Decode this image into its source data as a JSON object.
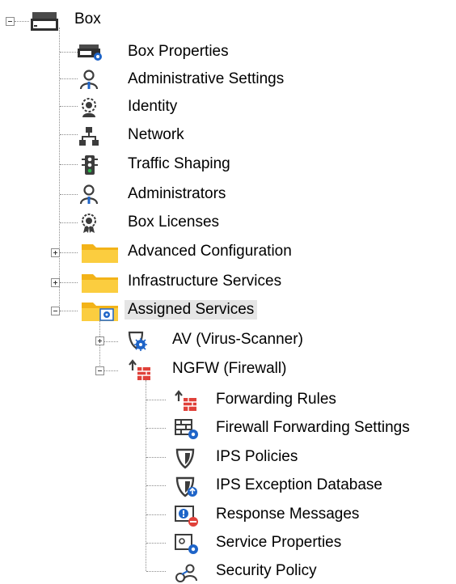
{
  "tree": {
    "root": {
      "label": "Box",
      "expanded": true
    },
    "items": [
      {
        "label": "Box Properties",
        "icon": "box-properties-icon"
      },
      {
        "label": "Administrative Settings",
        "icon": "admin-settings-icon"
      },
      {
        "label": "Identity",
        "icon": "identity-icon"
      },
      {
        "label": "Network",
        "icon": "network-icon"
      },
      {
        "label": "Traffic Shaping",
        "icon": "traffic-light-icon"
      },
      {
        "label": "Administrators",
        "icon": "administrators-icon"
      },
      {
        "label": "Box Licenses",
        "icon": "license-icon"
      },
      {
        "label": "Advanced Configuration",
        "icon": "folder-icon",
        "expanded": false
      },
      {
        "label": "Infrastructure Services",
        "icon": "folder-icon",
        "expanded": false
      },
      {
        "label": "Assigned Services",
        "icon": "services-folder-icon",
        "expanded": true,
        "selected": true
      }
    ],
    "services": [
      {
        "label": "AV (Virus-Scanner)",
        "icon": "virus-scanner-icon",
        "expanded": false
      },
      {
        "label": "NGFW (Firewall)",
        "icon": "firewall-icon",
        "expanded": true
      }
    ],
    "firewall_items": [
      {
        "label": "Forwarding Rules",
        "icon": "forwarding-rules-icon"
      },
      {
        "label": "Firewall Forwarding Settings",
        "icon": "forwarding-settings-icon"
      },
      {
        "label": "IPS Policies",
        "icon": "ips-shield-icon"
      },
      {
        "label": "IPS Exception Database",
        "icon": "ips-exception-icon"
      },
      {
        "label": "Response Messages",
        "icon": "response-messages-icon"
      },
      {
        "label": "Service Properties",
        "icon": "service-properties-icon"
      },
      {
        "label": "Security Policy",
        "icon": "security-policy-icon"
      }
    ],
    "colors": {
      "selection_bg": "#e5e5e5",
      "tree_lines": "#8c8c8c",
      "icon_blue": "#1e64c8",
      "icon_dark": "#3c3c3c",
      "folder_yellow": "#f5c233",
      "firewall_red": "#e0413a"
    }
  }
}
